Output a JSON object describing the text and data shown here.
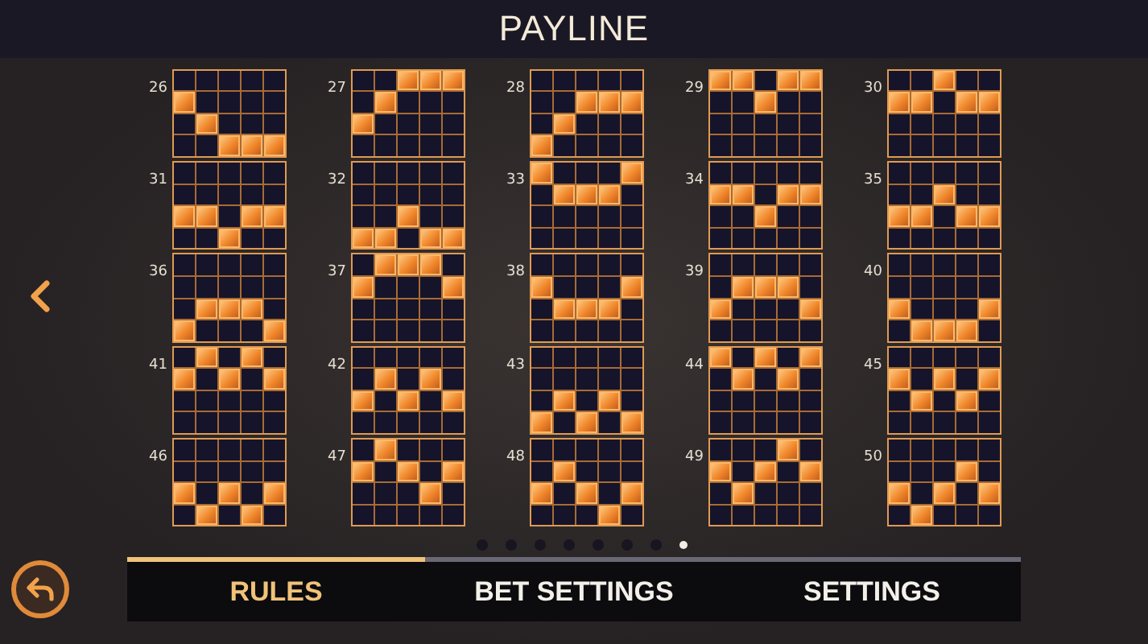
{
  "title": "PAYLINE",
  "paylines": [
    {
      "number": "26",
      "grid": [
        [
          false,
          false,
          false,
          false,
          false
        ],
        [
          true,
          false,
          false,
          false,
          false
        ],
        [
          false,
          true,
          false,
          false,
          false
        ],
        [
          false,
          false,
          true,
          true,
          true
        ]
      ]
    },
    {
      "number": "27",
      "grid": [
        [
          false,
          false,
          true,
          true,
          true
        ],
        [
          false,
          true,
          false,
          false,
          false
        ],
        [
          true,
          false,
          false,
          false,
          false
        ],
        [
          false,
          false,
          false,
          false,
          false
        ]
      ]
    },
    {
      "number": "28",
      "grid": [
        [
          false,
          false,
          false,
          false,
          false
        ],
        [
          false,
          false,
          true,
          true,
          true
        ],
        [
          false,
          true,
          false,
          false,
          false
        ],
        [
          true,
          false,
          false,
          false,
          false
        ]
      ]
    },
    {
      "number": "29",
      "grid": [
        [
          true,
          true,
          false,
          true,
          true
        ],
        [
          false,
          false,
          true,
          false,
          false
        ],
        [
          false,
          false,
          false,
          false,
          false
        ],
        [
          false,
          false,
          false,
          false,
          false
        ]
      ]
    },
    {
      "number": "30",
      "grid": [
        [
          false,
          false,
          true,
          false,
          false
        ],
        [
          true,
          true,
          false,
          true,
          true
        ],
        [
          false,
          false,
          false,
          false,
          false
        ],
        [
          false,
          false,
          false,
          false,
          false
        ]
      ]
    },
    {
      "number": "31",
      "grid": [
        [
          false,
          false,
          false,
          false,
          false
        ],
        [
          false,
          false,
          false,
          false,
          false
        ],
        [
          true,
          true,
          false,
          true,
          true
        ],
        [
          false,
          false,
          true,
          false,
          false
        ]
      ]
    },
    {
      "number": "32",
      "grid": [
        [
          false,
          false,
          false,
          false,
          false
        ],
        [
          false,
          false,
          false,
          false,
          false
        ],
        [
          false,
          false,
          true,
          false,
          false
        ],
        [
          true,
          true,
          false,
          true,
          true
        ]
      ]
    },
    {
      "number": "33",
      "grid": [
        [
          true,
          false,
          false,
          false,
          true
        ],
        [
          false,
          true,
          true,
          true,
          false
        ],
        [
          false,
          false,
          false,
          false,
          false
        ],
        [
          false,
          false,
          false,
          false,
          false
        ]
      ]
    },
    {
      "number": "34",
      "grid": [
        [
          false,
          false,
          false,
          false,
          false
        ],
        [
          true,
          true,
          false,
          true,
          true
        ],
        [
          false,
          false,
          true,
          false,
          false
        ],
        [
          false,
          false,
          false,
          false,
          false
        ]
      ]
    },
    {
      "number": "35",
      "grid": [
        [
          false,
          false,
          false,
          false,
          false
        ],
        [
          false,
          false,
          true,
          false,
          false
        ],
        [
          true,
          true,
          false,
          true,
          true
        ],
        [
          false,
          false,
          false,
          false,
          false
        ]
      ]
    },
    {
      "number": "36",
      "grid": [
        [
          false,
          false,
          false,
          false,
          false
        ],
        [
          false,
          false,
          false,
          false,
          false
        ],
        [
          false,
          true,
          true,
          true,
          false
        ],
        [
          true,
          false,
          false,
          false,
          true
        ]
      ]
    },
    {
      "number": "37",
      "grid": [
        [
          false,
          true,
          true,
          true,
          false
        ],
        [
          true,
          false,
          false,
          false,
          true
        ],
        [
          false,
          false,
          false,
          false,
          false
        ],
        [
          false,
          false,
          false,
          false,
          false
        ]
      ]
    },
    {
      "number": "38",
      "grid": [
        [
          false,
          false,
          false,
          false,
          false
        ],
        [
          true,
          false,
          false,
          false,
          true
        ],
        [
          false,
          true,
          true,
          true,
          false
        ],
        [
          false,
          false,
          false,
          false,
          false
        ]
      ]
    },
    {
      "number": "39",
      "grid": [
        [
          false,
          false,
          false,
          false,
          false
        ],
        [
          false,
          true,
          true,
          true,
          false
        ],
        [
          true,
          false,
          false,
          false,
          true
        ],
        [
          false,
          false,
          false,
          false,
          false
        ]
      ]
    },
    {
      "number": "40",
      "grid": [
        [
          false,
          false,
          false,
          false,
          false
        ],
        [
          false,
          false,
          false,
          false,
          false
        ],
        [
          true,
          false,
          false,
          false,
          true
        ],
        [
          false,
          true,
          true,
          true,
          false
        ]
      ]
    },
    {
      "number": "41",
      "grid": [
        [
          false,
          true,
          false,
          true,
          false
        ],
        [
          true,
          false,
          true,
          false,
          true
        ],
        [
          false,
          false,
          false,
          false,
          false
        ],
        [
          false,
          false,
          false,
          false,
          false
        ]
      ]
    },
    {
      "number": "42",
      "grid": [
        [
          false,
          false,
          false,
          false,
          false
        ],
        [
          false,
          true,
          false,
          true,
          false
        ],
        [
          true,
          false,
          true,
          false,
          true
        ],
        [
          false,
          false,
          false,
          false,
          false
        ]
      ]
    },
    {
      "number": "43",
      "grid": [
        [
          false,
          false,
          false,
          false,
          false
        ],
        [
          false,
          false,
          false,
          false,
          false
        ],
        [
          false,
          true,
          false,
          true,
          false
        ],
        [
          true,
          false,
          true,
          false,
          true
        ]
      ]
    },
    {
      "number": "44",
      "grid": [
        [
          true,
          false,
          true,
          false,
          true
        ],
        [
          false,
          true,
          false,
          true,
          false
        ],
        [
          false,
          false,
          false,
          false,
          false
        ],
        [
          false,
          false,
          false,
          false,
          false
        ]
      ]
    },
    {
      "number": "45",
      "grid": [
        [
          false,
          false,
          false,
          false,
          false
        ],
        [
          true,
          false,
          true,
          false,
          true
        ],
        [
          false,
          true,
          false,
          true,
          false
        ],
        [
          false,
          false,
          false,
          false,
          false
        ]
      ]
    },
    {
      "number": "46",
      "grid": [
        [
          false,
          false,
          false,
          false,
          false
        ],
        [
          false,
          false,
          false,
          false,
          false
        ],
        [
          true,
          false,
          true,
          false,
          true
        ],
        [
          false,
          true,
          false,
          true,
          false
        ]
      ]
    },
    {
      "number": "47",
      "grid": [
        [
          false,
          true,
          false,
          false,
          false
        ],
        [
          true,
          false,
          true,
          false,
          true
        ],
        [
          false,
          false,
          false,
          true,
          false
        ],
        [
          false,
          false,
          false,
          false,
          false
        ]
      ]
    },
    {
      "number": "48",
      "grid": [
        [
          false,
          false,
          false,
          false,
          false
        ],
        [
          false,
          true,
          false,
          false,
          false
        ],
        [
          true,
          false,
          true,
          false,
          true
        ],
        [
          false,
          false,
          false,
          true,
          false
        ]
      ]
    },
    {
      "number": "49",
      "grid": [
        [
          false,
          false,
          false,
          true,
          false
        ],
        [
          true,
          false,
          true,
          false,
          true
        ],
        [
          false,
          true,
          false,
          false,
          false
        ],
        [
          false,
          false,
          false,
          false,
          false
        ]
      ]
    },
    {
      "number": "50",
      "grid": [
        [
          false,
          false,
          false,
          false,
          false
        ],
        [
          false,
          false,
          false,
          true,
          false
        ],
        [
          true,
          false,
          true,
          false,
          true
        ],
        [
          false,
          true,
          false,
          false,
          false
        ]
      ]
    }
  ],
  "page_dots": [
    {
      "selected": false
    },
    {
      "selected": false
    },
    {
      "selected": false
    },
    {
      "selected": false
    },
    {
      "selected": false
    },
    {
      "selected": false
    },
    {
      "selected": false
    },
    {
      "selected": true
    }
  ],
  "tabs": [
    {
      "label": "RULES",
      "selected": true
    },
    {
      "label": "BET SETTINGS",
      "selected": false
    },
    {
      "label": "SETTINGS",
      "selected": false
    }
  ]
}
